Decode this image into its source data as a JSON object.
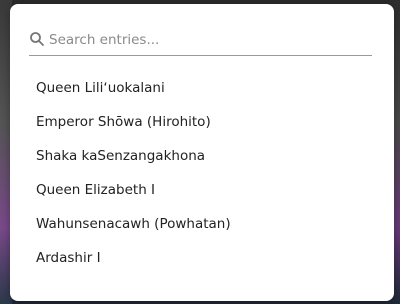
{
  "search": {
    "placeholder": "Search entries...",
    "value": "",
    "icon": "search-icon"
  },
  "results": [
    {
      "label": "Queen Liliʻuokalani"
    },
    {
      "label": "Emperor Shōwa (Hirohito)"
    },
    {
      "label": "Shaka kaSenzangakhona"
    },
    {
      "label": "Queen Elizabeth I"
    },
    {
      "label": "Wahunsenacawh (Powhatan)"
    },
    {
      "label": "Ardashir I"
    }
  ],
  "colors": {
    "dialog_background": "#ffffff",
    "text": "#222222",
    "placeholder": "#8a8a8a",
    "divider": "#9a9a9a"
  }
}
